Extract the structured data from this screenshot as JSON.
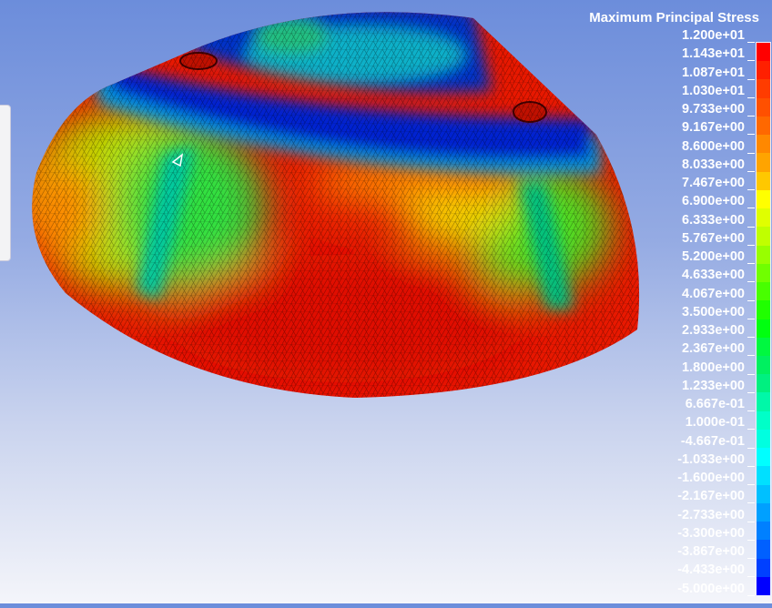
{
  "legend": {
    "title": "Maximum Principal Stress",
    "labels": [
      "1.200e+01",
      "1.143e+01",
      "1.087e+01",
      "1.030e+01",
      "9.733e+00",
      "9.167e+00",
      "8.600e+00",
      "8.033e+00",
      "7.467e+00",
      "6.900e+00",
      "6.333e+00",
      "5.767e+00",
      "5.200e+00",
      "4.633e+00",
      "4.067e+00",
      "3.500e+00",
      "2.933e+00",
      "2.367e+00",
      "1.800e+00",
      "1.233e+00",
      "6.667e-01",
      "1.000e-01",
      "-4.667e-01",
      "-1.033e+00",
      "-1.600e+00",
      "-2.167e+00",
      "-2.733e+00",
      "-3.300e+00",
      "-3.867e+00",
      "-4.433e+00",
      "-5.000e+00"
    ],
    "colors": [
      "#ff0000",
      "#ff2000",
      "#ff3c00",
      "#ff5000",
      "#ff6800",
      "#ff8800",
      "#ffa400",
      "#ffc800",
      "#ffff00",
      "#e0ff00",
      "#c0ff00",
      "#98ff00",
      "#70ff00",
      "#48ff00",
      "#20ff00",
      "#00ff10",
      "#00f840",
      "#00f060",
      "#00f080",
      "#00f8a8",
      "#00ffc8",
      "#00ffe0",
      "#00ffff",
      "#00e0ff",
      "#00c0ff",
      "#00a0ff",
      "#0080ff",
      "#0060ff",
      "#0040ff",
      "#0000ff"
    ]
  }
}
